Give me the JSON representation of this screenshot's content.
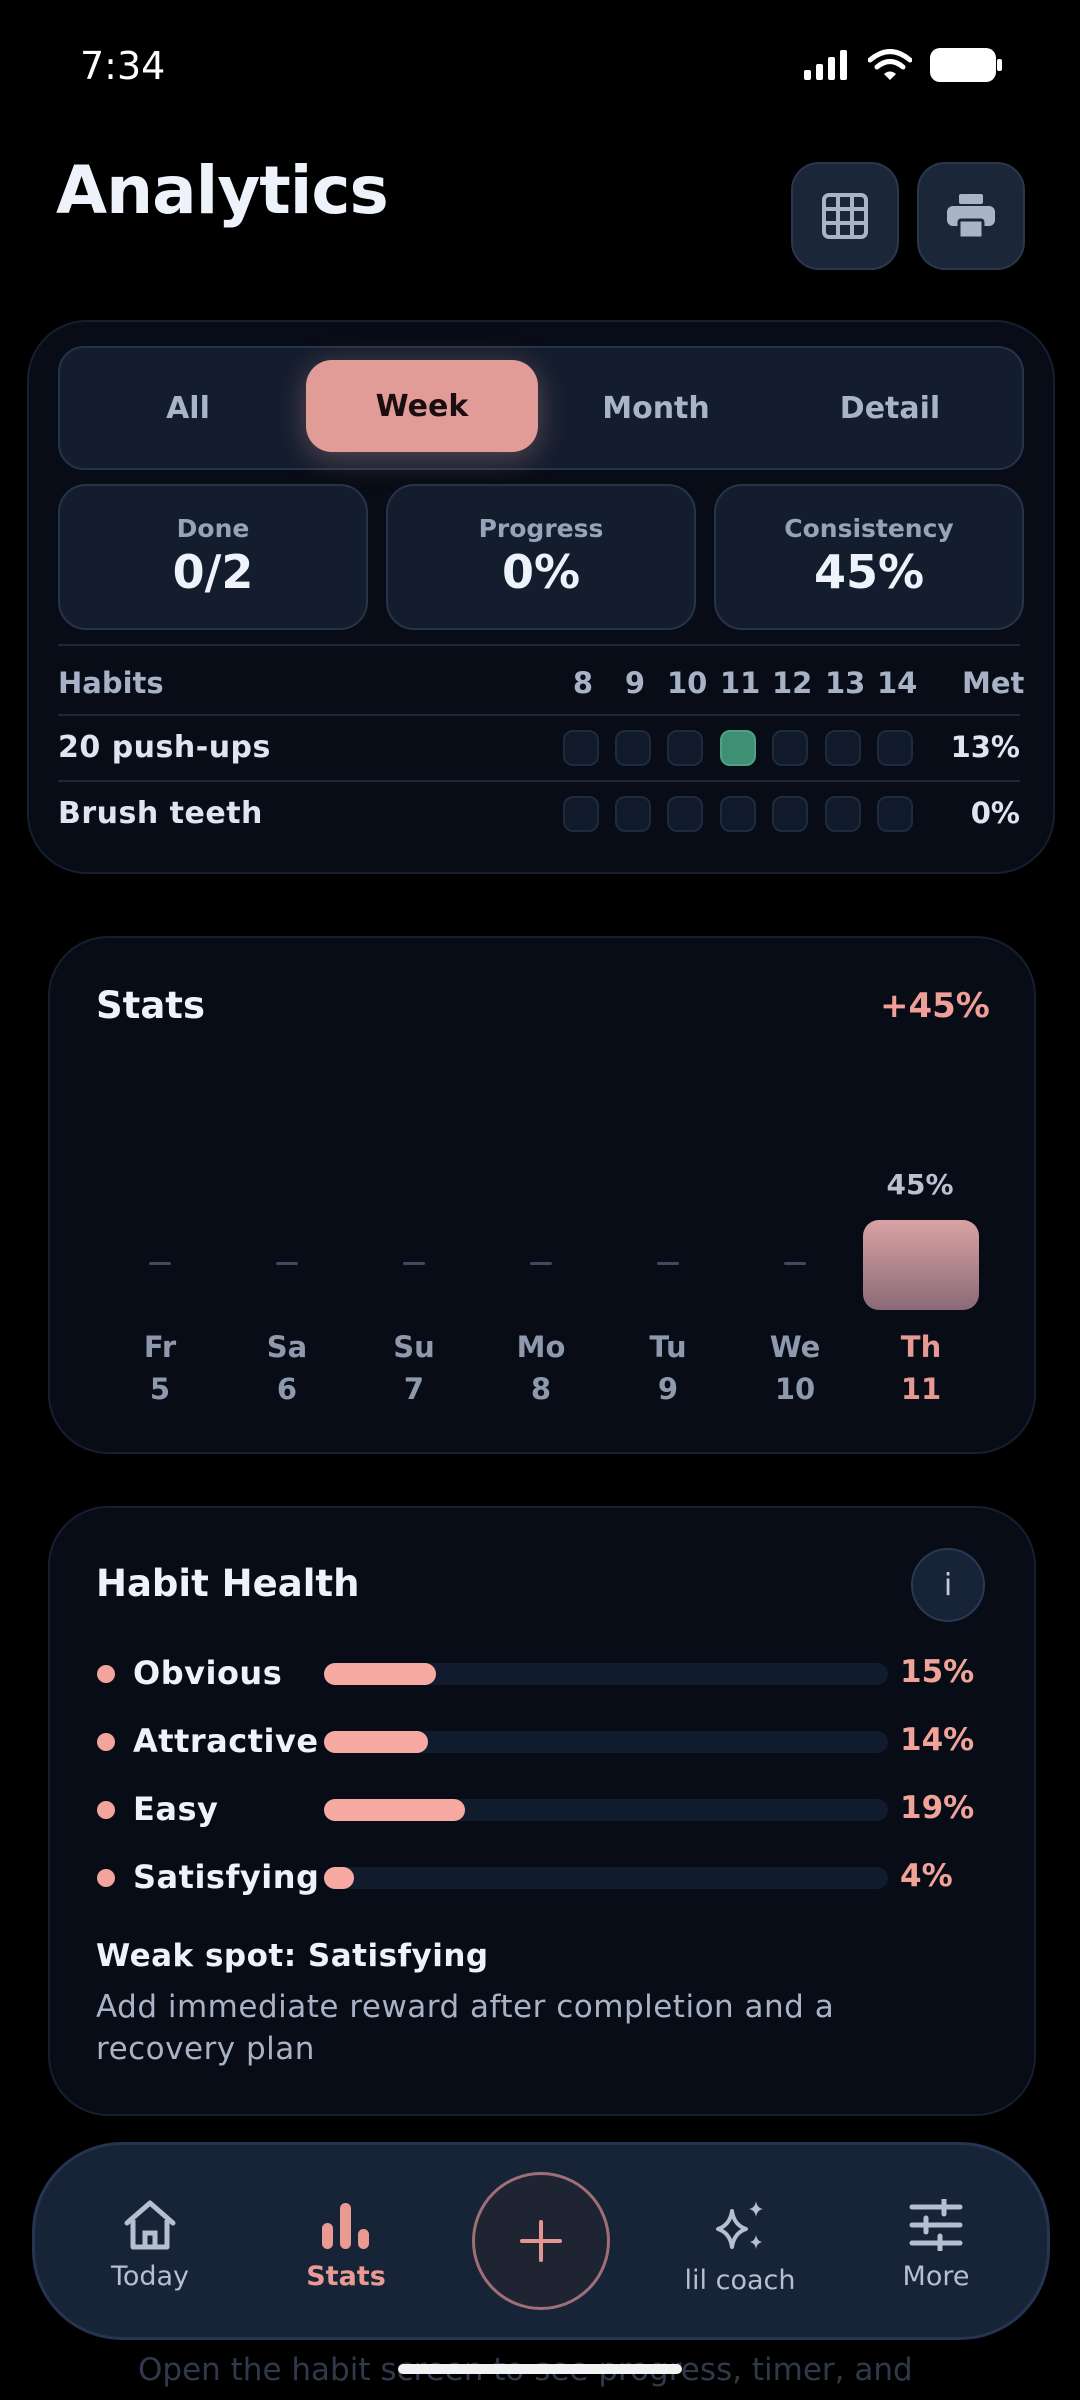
{
  "status": {
    "time": "7:34"
  },
  "header": {
    "title": "Analytics",
    "grid_icon": "grid-icon",
    "print_icon": "printer-icon"
  },
  "tabs": [
    {
      "label": "All",
      "active": false
    },
    {
      "label": "Week",
      "active": true
    },
    {
      "label": "Month",
      "active": false
    },
    {
      "label": "Detail",
      "active": false
    }
  ],
  "metrics": [
    {
      "label": "Done",
      "value": "0/2"
    },
    {
      "label": "Progress",
      "value": "0%"
    },
    {
      "label": "Consistency",
      "value": "45%"
    }
  ],
  "habit_table": {
    "col_habits": "Habits",
    "col_met": "Met",
    "days": [
      "8",
      "9",
      "10",
      "11",
      "12",
      "13",
      "14"
    ],
    "rows": [
      {
        "name": "20 push-ups",
        "done": [
          false,
          false,
          false,
          true,
          false,
          false,
          false
        ],
        "met": "13%"
      },
      {
        "name": "Brush teeth",
        "done": [
          false,
          false,
          false,
          false,
          false,
          false,
          false
        ],
        "met": "0%"
      }
    ]
  },
  "stats": {
    "title": "Stats",
    "delta": "+45%",
    "days": [
      {
        "dow": "Fr",
        "date": "5",
        "value": null
      },
      {
        "dow": "Sa",
        "date": "6",
        "value": null
      },
      {
        "dow": "Su",
        "date": "7",
        "value": null
      },
      {
        "dow": "Mo",
        "date": "8",
        "value": null
      },
      {
        "dow": "Tu",
        "date": "9",
        "value": null
      },
      {
        "dow": "We",
        "date": "10",
        "value": null
      },
      {
        "dow": "Th",
        "date": "11",
        "value": 45,
        "label": "45%",
        "today": true
      }
    ]
  },
  "health": {
    "title": "Habit Health",
    "info_label": "i",
    "items": [
      {
        "name": "Obvious",
        "percent": 15,
        "label": "15%"
      },
      {
        "name": "Attractive",
        "percent": 14,
        "label": "14%"
      },
      {
        "name": "Easy",
        "percent": 19,
        "label": "19%"
      },
      {
        "name": "Satisfying",
        "percent": 4,
        "label": "4%"
      }
    ],
    "weak_spot": "Weak spot: Satisfying",
    "advice": "Add immediate reward after completion and a recovery plan"
  },
  "peek_text": "Open the habit screen to see progress, timer, and",
  "nav": [
    {
      "label": "Today",
      "icon": "home-icon",
      "active": false
    },
    {
      "label": "Stats",
      "icon": "bar-chart-icon",
      "active": true
    },
    {
      "label": "lil coach",
      "icon": "sparkles-icon",
      "active": false
    },
    {
      "label": "More",
      "icon": "sliders-icon",
      "active": false
    }
  ],
  "fab_icon": "plus-icon",
  "colors": {
    "accent": "#e29c98",
    "done_green": "#3f8f74",
    "background": "#000000",
    "card": "#070c16"
  }
}
